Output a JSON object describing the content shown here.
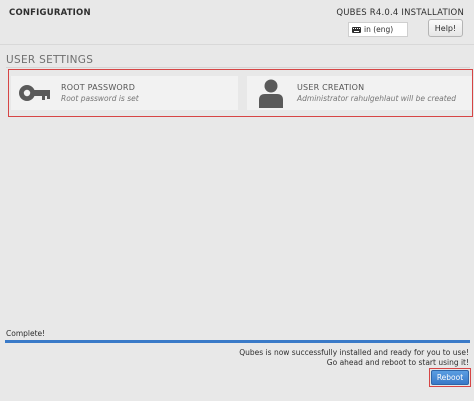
{
  "header": {
    "title": "CONFIGURATION",
    "product": "QUBES R4.0.4 INSTALLATION",
    "keyboard_layout": "in (eng)",
    "help_label": "Help!"
  },
  "user_settings": {
    "title": "USER SETTINGS",
    "spokes": [
      {
        "title": "ROOT PASSWORD",
        "status": "Root password is set",
        "icon": "key-icon"
      },
      {
        "title": "USER CREATION",
        "status": "Administrator rahulgehlaut will be created",
        "icon": "user-icon"
      }
    ]
  },
  "progress": {
    "label": "Complete!",
    "fraction": 1.0
  },
  "completion": {
    "line1": "Qubes is now successfully installed and ready for you to use!",
    "line2": "Go ahead and reboot to start using it!"
  },
  "reboot_label": "Reboot",
  "colors": {
    "accent": "#3a7ac8",
    "highlight": "#d64545"
  }
}
